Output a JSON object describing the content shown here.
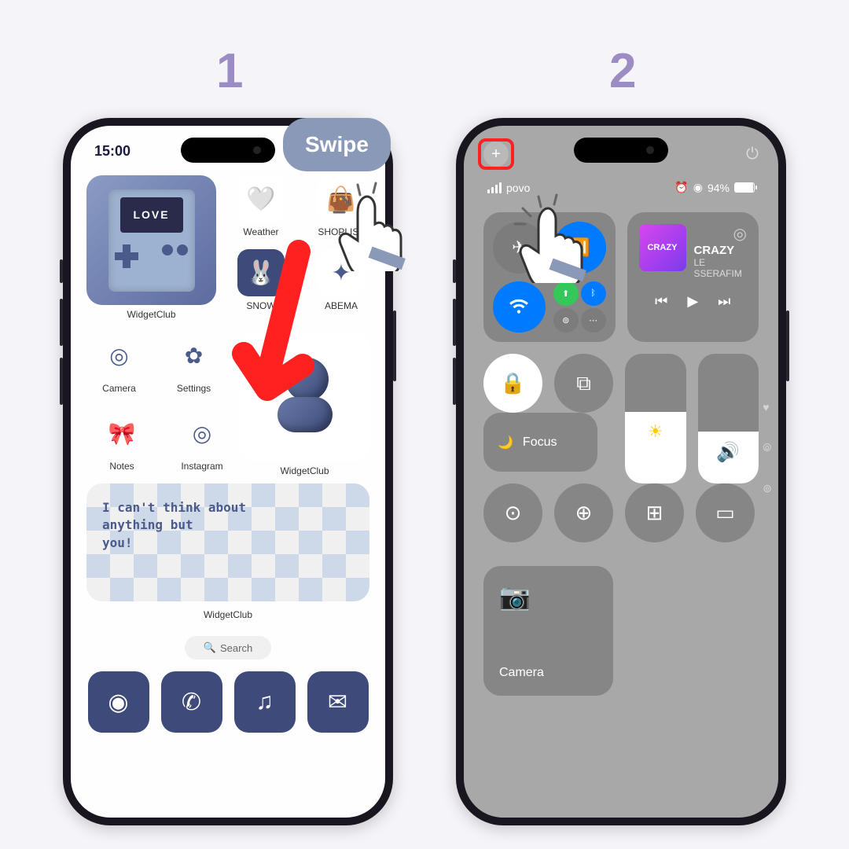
{
  "steps": {
    "one": "1",
    "two": "2"
  },
  "swipe_label": "Swipe",
  "phone1": {
    "time": "15:00",
    "widget_gameboy": "LOVE",
    "apps": {
      "widgetclub": "WidgetClub",
      "weather": "Weather",
      "shoplist": "SHOPLIST",
      "snow": "SNOW",
      "abema": "ABEMA",
      "camera": "Camera",
      "settings": "Settings",
      "notes": "Notes",
      "instagram": "Instagram",
      "widgetclub2": "WidgetClub",
      "widgetclub3": "WidgetClub"
    },
    "banner_text": "I can't think about\nanything but\nyou!",
    "search": "Search"
  },
  "phone2": {
    "carrier": "povo",
    "battery_pct": "94%",
    "music": {
      "title": "CRAZY",
      "artist": "LE SSERAFIM",
      "art_text": "CRAZY"
    },
    "focus": "Focus",
    "camera": "Camera"
  }
}
